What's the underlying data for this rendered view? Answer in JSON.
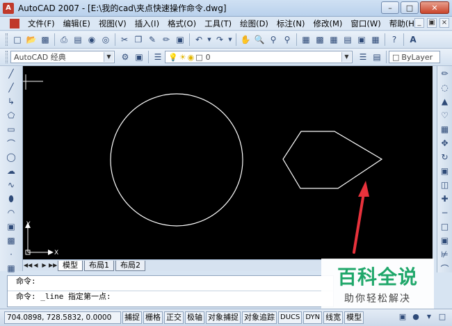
{
  "window": {
    "title": "AutoCAD 2007 - [E:\\我的cad\\夹点快速操作命令.dwg]",
    "app_icon_label": "A"
  },
  "menu": {
    "items": [
      "文件(F)",
      "编辑(E)",
      "视图(V)",
      "插入(I)",
      "格式(O)",
      "工具(T)",
      "绘图(D)",
      "标注(N)",
      "修改(M)",
      "窗口(W)",
      "帮助(H)"
    ]
  },
  "toolbar2": {
    "workspace": "AutoCAD 经典",
    "layer": "0",
    "color": "ByLayer"
  },
  "tabs": {
    "model": "模型",
    "layout1": "布局1",
    "layout2": "布局2"
  },
  "ucs": {
    "y_label": "Y",
    "x_label": "X"
  },
  "command": {
    "line1": "命令:",
    "line2": "命令: _line 指定第一点:"
  },
  "status": {
    "coords": "704.0898,  728.5832, 0.0000",
    "buttons": [
      "捕捉",
      "栅格",
      "正交",
      "极轴",
      "对象捕捉",
      "对象追踪",
      "DUCS",
      "DYN",
      "线宽",
      "模型"
    ]
  },
  "watermark": {
    "main": "百科全说",
    "sub": "助你轻松解决"
  },
  "colors": {
    "drawing_bg": "#000000",
    "entity": "#ffffff",
    "arrow": "#e8323c",
    "watermark_green": "#1fa76a"
  }
}
